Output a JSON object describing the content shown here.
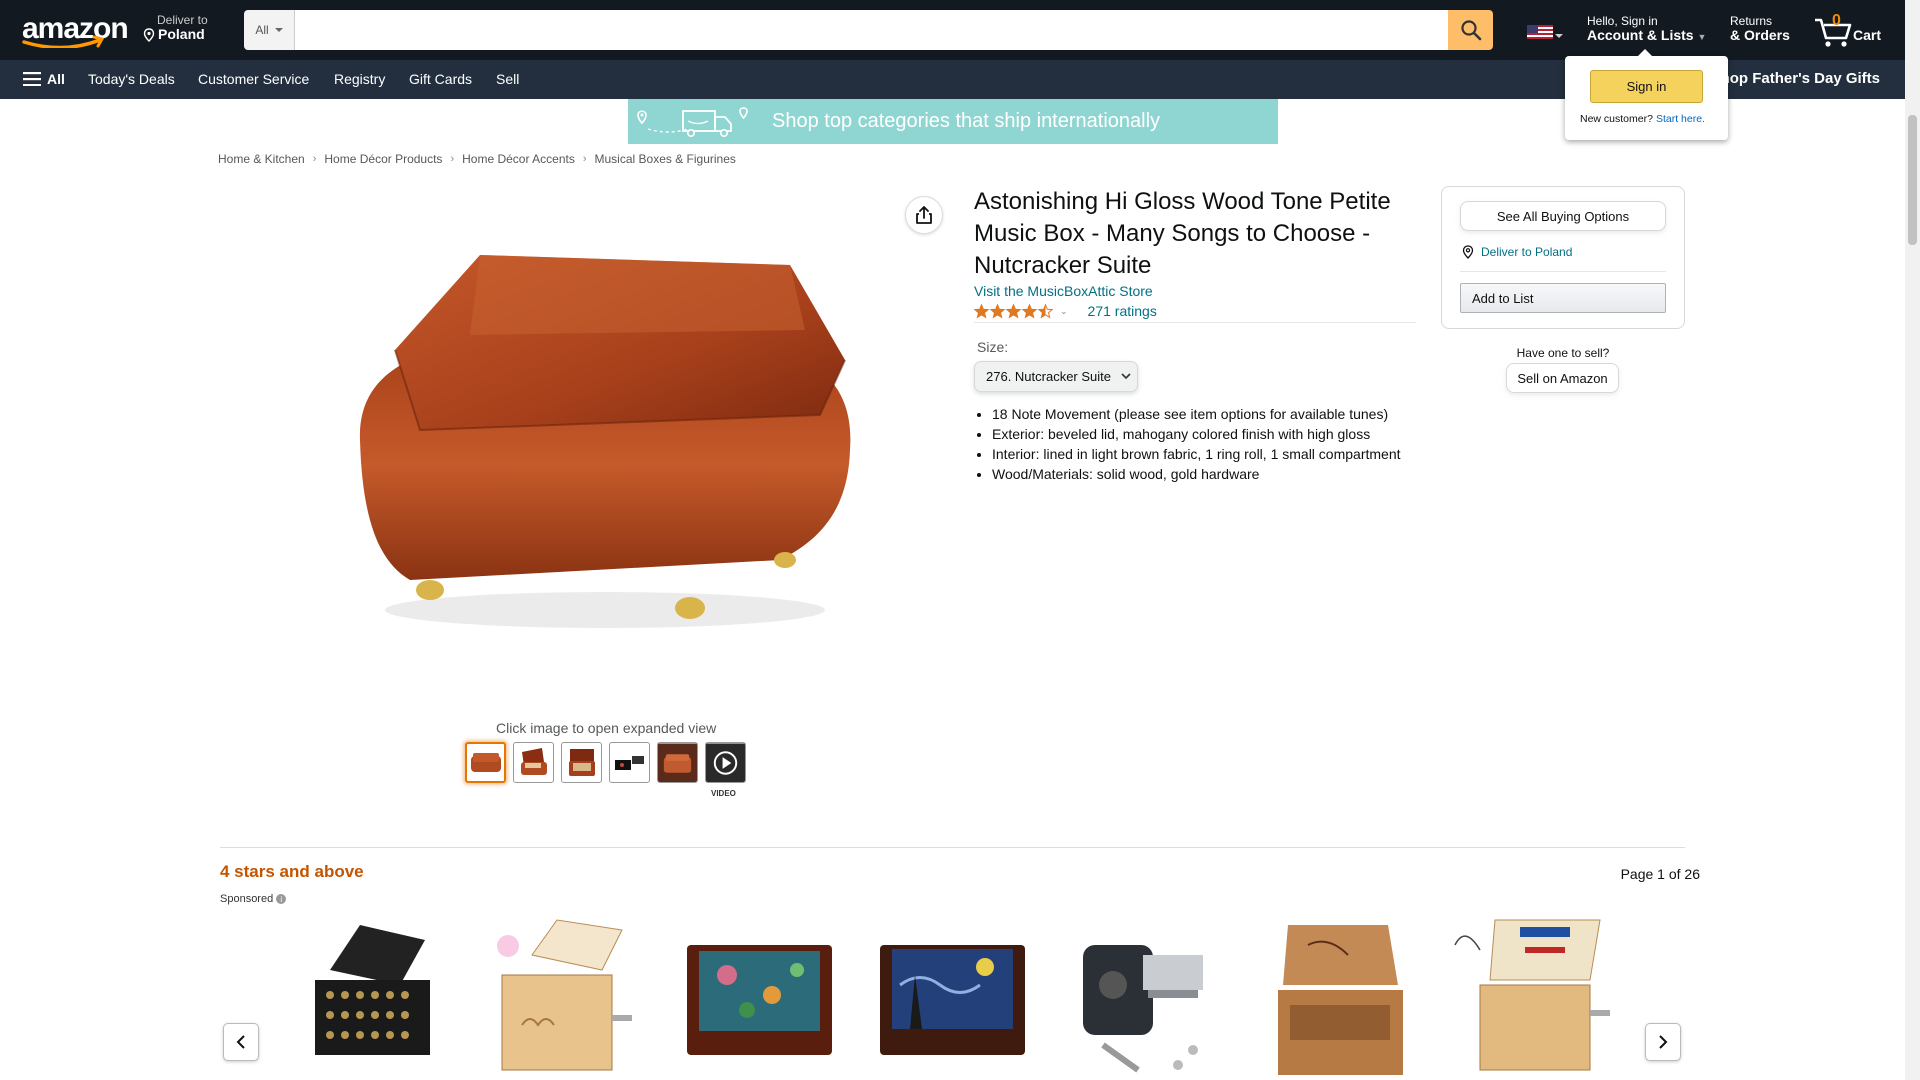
{
  "header": {
    "logo_text": "amazon",
    "deliver_to": "Deliver to",
    "deliver_country": "Poland",
    "search_dept": "All",
    "search_placeholder": "",
    "account_greeting": "Hello, Sign in",
    "account_label": "Account & Lists",
    "returns_l1": "Returns",
    "returns_l2": "& Orders",
    "cart_count": "0",
    "cart_label": "Cart"
  },
  "subnav": {
    "all_label": "All",
    "items": [
      "Today's Deals",
      "Customer Service",
      "Registry",
      "Gift Cards",
      "Sell"
    ],
    "promo": "Shop Father's Day Gifts"
  },
  "flyout": {
    "signin_label": "Sign in",
    "new_customer": "New customer?",
    "start_here": "Start here."
  },
  "banner": {
    "text": "Shop top categories that ship internationally"
  },
  "breadcrumb": [
    "Home & Kitchen",
    "Home Décor Products",
    "Home Décor Accents",
    "Musical Boxes & Figurines"
  ],
  "gallery": {
    "expand_text": "Click image to open expanded view",
    "video_label": "VIDEO"
  },
  "product": {
    "title": "Astonishing Hi Gloss Wood Tone Petite Music Box - Many Songs to Choose - Nutcracker Suite",
    "store_link": "Visit the MusicBoxAttic Store",
    "rating_value": 4.5,
    "ratings_count": "271 ratings",
    "size_label": "Size:",
    "size_value": "276. Nutcracker Suite",
    "bullets": [
      "18 Note Movement (please see item options for available tunes)",
      "Exterior: beveled lid, mahogany colored finish with high gloss",
      "Interior: lined in light brown fabric, 1 ring roll, 1 small compartment",
      "Wood/Materials: solid wood, gold hardware"
    ]
  },
  "buybox": {
    "see_all": "See All Buying Options",
    "deliver_link": "Deliver to Poland",
    "add_to_list": "Add to List",
    "have_one": "Have one to sell?",
    "sell_on_amazon": "Sell on Amazon"
  },
  "carousel": {
    "title": "4 stars and above",
    "sponsored": "Sponsored",
    "page": "Page 1 of 26"
  },
  "colors": {
    "nav_dark": "#131921",
    "nav_sub": "#232f3e",
    "search_button": "#febd69",
    "link": "#007185",
    "accent_orange": "#c45500",
    "star": "#de7921"
  }
}
